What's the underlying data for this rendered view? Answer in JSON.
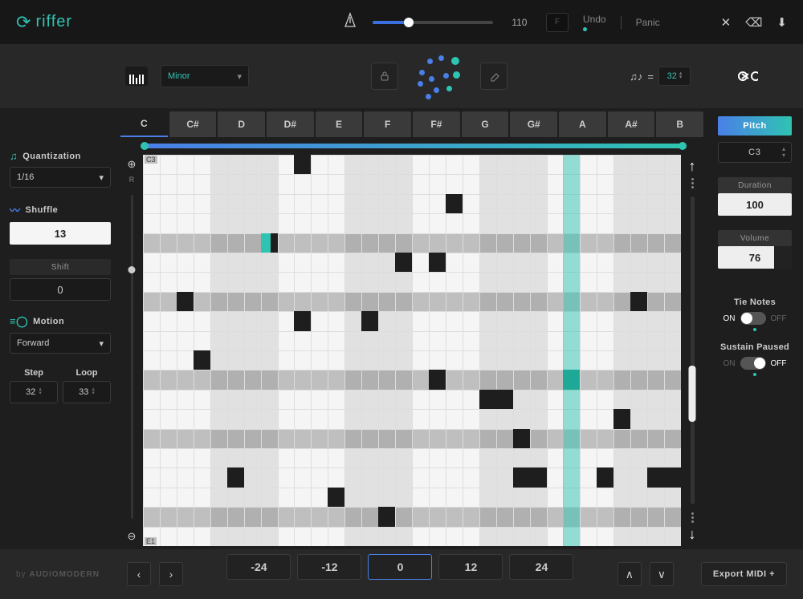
{
  "app": {
    "name": "riffer",
    "tempo": 110,
    "tempo_key": "F",
    "undo": "Undo",
    "panic": "Panic"
  },
  "toolbar": {
    "scale": "Minor",
    "steps": 32
  },
  "left": {
    "quantization": {
      "label": "Quantization",
      "value": "1/16"
    },
    "shuffle": {
      "label": "Shuffle",
      "value": "13"
    },
    "shift": {
      "label": "Shift",
      "value": "0"
    },
    "motion": {
      "label": "Motion",
      "value": "Forward"
    },
    "step": {
      "label": "Step",
      "value": "32"
    },
    "loop": {
      "label": "Loop",
      "value": "33"
    }
  },
  "tabs": [
    "C",
    "C#",
    "D",
    "D#",
    "E",
    "F",
    "F#",
    "G",
    "G#",
    "A",
    "A#",
    "B"
  ],
  "tabs_active": 0,
  "grid": {
    "top_octave": "C3",
    "bottom_octave": "E1",
    "rows": 20,
    "cols": 32,
    "playhead_col": 25,
    "shaded_rows": [
      4,
      7,
      11,
      14,
      18
    ],
    "shaded_col_groups": [
      [
        4,
        7
      ],
      [
        12,
        15
      ],
      [
        20,
        23
      ],
      [
        28,
        31
      ]
    ],
    "highlight_cell": {
      "row": 4,
      "col": 7
    },
    "play_cell": {
      "row": 11,
      "col": 25
    },
    "notes": [
      {
        "row": 0,
        "col": 9
      },
      {
        "row": 2,
        "col": 18
      },
      {
        "row": 4,
        "col": 7
      },
      {
        "row": 5,
        "col": 15
      },
      {
        "row": 5,
        "col": 17
      },
      {
        "row": 7,
        "col": 2
      },
      {
        "row": 7,
        "col": 29
      },
      {
        "row": 8,
        "col": 9
      },
      {
        "row": 8,
        "col": 13
      },
      {
        "row": 10,
        "col": 3
      },
      {
        "row": 11,
        "col": 17
      },
      {
        "row": 12,
        "col": 20
      },
      {
        "row": 12,
        "col": 21
      },
      {
        "row": 13,
        "col": 28
      },
      {
        "row": 14,
        "col": 22
      },
      {
        "row": 16,
        "col": 5
      },
      {
        "row": 16,
        "col": 22
      },
      {
        "row": 16,
        "col": 23
      },
      {
        "row": 16,
        "col": 27
      },
      {
        "row": 16,
        "col": 30
      },
      {
        "row": 16,
        "col": 31
      },
      {
        "row": 17,
        "col": 11
      },
      {
        "row": 18,
        "col": 14
      }
    ]
  },
  "right": {
    "pitch": {
      "label": "Pitch",
      "value": "C3"
    },
    "duration": {
      "label": "Duration",
      "value": "100"
    },
    "volume": {
      "label": "Volume",
      "value": "76"
    },
    "tie": {
      "label": "Tie Notes",
      "state": "ON"
    },
    "sustain": {
      "label": "Sustain Paused",
      "state": "OFF"
    },
    "on": "ON",
    "off": "OFF"
  },
  "bottom": {
    "brand_pre": "by ",
    "brand": "AUDIOMODERN",
    "octaves": [
      "-24",
      "-12",
      "0",
      "12",
      "24"
    ],
    "octave_sel": 2,
    "export": "Export MIDI +"
  }
}
